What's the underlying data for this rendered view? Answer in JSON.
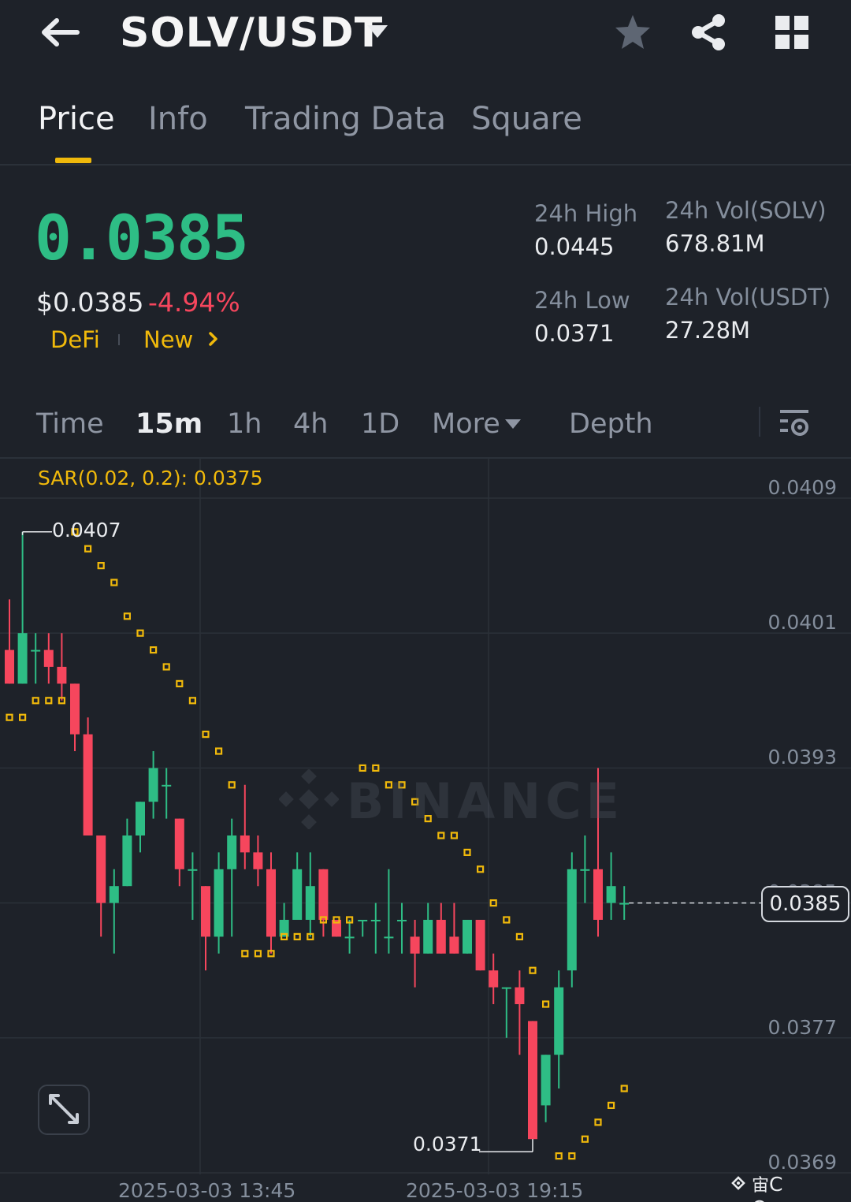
{
  "header": {
    "pair": "SOLV/USDT",
    "icons": [
      "back-arrow-icon",
      "chevron-down-icon",
      "star-icon",
      "share-icon",
      "grid-icon"
    ]
  },
  "tabs": [
    {
      "label": "Price",
      "active": true
    },
    {
      "label": "Info",
      "active": false
    },
    {
      "label": "Trading Data",
      "active": false
    },
    {
      "label": "Square",
      "active": false
    }
  ],
  "ticker": {
    "last_price": "0.0385",
    "usd_price": "$0.0385",
    "change_pct": "-4.94%",
    "tags": [
      "DeFi",
      "New"
    ],
    "stats": {
      "high_label": "24h High",
      "high_value": "0.0445",
      "low_label": "24h Low",
      "low_value": "0.0371",
      "vol_base_label": "24h Vol(SOLV)",
      "vol_base_value": "678.81M",
      "vol_quote_label": "24h Vol(USDT)",
      "vol_quote_value": "27.28M"
    }
  },
  "intervals": {
    "items": [
      "Time",
      "15m",
      "1h",
      "4h",
      "1D",
      "More"
    ],
    "active": "15m",
    "depth_label": "Depth"
  },
  "chart": {
    "indicator_label": "SAR(0.02, 0.2): 0.0375",
    "y_ticks": [
      "0.0409",
      "0.0401",
      "0.0393",
      "0.0385",
      "0.0377",
      "0.0369"
    ],
    "x_ticks": [
      "2025-03-03 13:45",
      "2025-03-03 19:15"
    ],
    "high_marker": "0.0407",
    "low_marker": "0.0371",
    "current_price_tag": "0.0385",
    "watermark": "BINANCE",
    "colors": {
      "up": "#2ebd85",
      "down": "#f6465d",
      "sar": "#f0b90b"
    }
  },
  "credit": "C Queen",
  "chart_data": {
    "type": "candlestick",
    "ylim": [
      0.0367,
      0.0411
    ],
    "y_ticks": [
      0.0409,
      0.0401,
      0.0393,
      0.0385,
      0.0377,
      0.0369
    ],
    "candles": [
      {
        "o": 0.04,
        "h": 0.0403,
        "l": 0.0398,
        "c": 0.0398
      },
      {
        "o": 0.0398,
        "h": 0.0407,
        "l": 0.0398,
        "c": 0.0401
      },
      {
        "o": 0.04,
        "h": 0.0401,
        "l": 0.0398,
        "c": 0.04
      },
      {
        "o": 0.04,
        "h": 0.0401,
        "l": 0.0398,
        "c": 0.0399
      },
      {
        "o": 0.0399,
        "h": 0.0401,
        "l": 0.0397,
        "c": 0.0398
      },
      {
        "o": 0.0398,
        "h": 0.0398,
        "l": 0.0394,
        "c": 0.0395
      },
      {
        "o": 0.0395,
        "h": 0.0396,
        "l": 0.0389,
        "c": 0.0389
      },
      {
        "o": 0.0389,
        "h": 0.0389,
        "l": 0.0383,
        "c": 0.0385
      },
      {
        "o": 0.0385,
        "h": 0.0387,
        "l": 0.0382,
        "c": 0.0386
      },
      {
        "o": 0.0386,
        "h": 0.039,
        "l": 0.0386,
        "c": 0.0389
      },
      {
        "o": 0.0389,
        "h": 0.0391,
        "l": 0.0388,
        "c": 0.0391
      },
      {
        "o": 0.0391,
        "h": 0.0394,
        "l": 0.039,
        "c": 0.0393
      },
      {
        "o": 0.0392,
        "h": 0.0393,
        "l": 0.039,
        "c": 0.0392
      },
      {
        "o": 0.039,
        "h": 0.039,
        "l": 0.0386,
        "c": 0.0387
      },
      {
        "o": 0.0387,
        "h": 0.0388,
        "l": 0.0384,
        "c": 0.0387
      },
      {
        "o": 0.0386,
        "h": 0.0386,
        "l": 0.0381,
        "c": 0.0383
      },
      {
        "o": 0.0383,
        "h": 0.0388,
        "l": 0.0382,
        "c": 0.0387
      },
      {
        "o": 0.0387,
        "h": 0.039,
        "l": 0.0383,
        "c": 0.0389
      },
      {
        "o": 0.0389,
        "h": 0.0392,
        "l": 0.0387,
        "c": 0.0388
      },
      {
        "o": 0.0388,
        "h": 0.0389,
        "l": 0.0386,
        "c": 0.0387
      },
      {
        "o": 0.0387,
        "h": 0.0388,
        "l": 0.0382,
        "c": 0.0383
      },
      {
        "o": 0.0383,
        "h": 0.0385,
        "l": 0.0383,
        "c": 0.0384
      },
      {
        "o": 0.0384,
        "h": 0.0388,
        "l": 0.0384,
        "c": 0.0387
      },
      {
        "o": 0.0384,
        "h": 0.0388,
        "l": 0.0383,
        "c": 0.0386
      },
      {
        "o": 0.0387,
        "h": 0.0387,
        "l": 0.0383,
        "c": 0.0384
      },
      {
        "o": 0.0384,
        "h": 0.0384,
        "l": 0.0383,
        "c": 0.0383
      },
      {
        "o": 0.0383,
        "h": 0.0384,
        "l": 0.0382,
        "c": 0.0383
      },
      {
        "o": 0.0384,
        "h": 0.0384,
        "l": 0.0383,
        "c": 0.0384
      },
      {
        "o": 0.0384,
        "h": 0.0385,
        "l": 0.0382,
        "c": 0.0384
      },
      {
        "o": 0.0383,
        "h": 0.0387,
        "l": 0.0382,
        "c": 0.0383
      },
      {
        "o": 0.0384,
        "h": 0.0385,
        "l": 0.0382,
        "c": 0.0384
      },
      {
        "o": 0.0383,
        "h": 0.0384,
        "l": 0.038,
        "c": 0.0382
      },
      {
        "o": 0.0382,
        "h": 0.0385,
        "l": 0.0382,
        "c": 0.0384
      },
      {
        "o": 0.0384,
        "h": 0.0385,
        "l": 0.0382,
        "c": 0.0382
      },
      {
        "o": 0.0383,
        "h": 0.0385,
        "l": 0.0382,
        "c": 0.0382
      },
      {
        "o": 0.0382,
        "h": 0.0384,
        "l": 0.0382,
        "c": 0.0384
      },
      {
        "o": 0.0384,
        "h": 0.0384,
        "l": 0.0381,
        "c": 0.0381
      },
      {
        "o": 0.0381,
        "h": 0.0382,
        "l": 0.0379,
        "c": 0.038
      },
      {
        "o": 0.038,
        "h": 0.038,
        "l": 0.0377,
        "c": 0.038
      },
      {
        "o": 0.038,
        "h": 0.0381,
        "l": 0.0376,
        "c": 0.0379
      },
      {
        "o": 0.0378,
        "h": 0.0378,
        "l": 0.0371,
        "c": 0.0371
      },
      {
        "o": 0.0373,
        "h": 0.0376,
        "l": 0.0372,
        "c": 0.0376
      },
      {
        "o": 0.0376,
        "h": 0.0381,
        "l": 0.0374,
        "c": 0.038
      },
      {
        "o": 0.0381,
        "h": 0.0388,
        "l": 0.038,
        "c": 0.0387
      },
      {
        "o": 0.0387,
        "h": 0.0389,
        "l": 0.0385,
        "c": 0.0387
      },
      {
        "o": 0.0387,
        "h": 0.0393,
        "l": 0.0383,
        "c": 0.0384
      },
      {
        "o": 0.0385,
        "h": 0.0388,
        "l": 0.0384,
        "c": 0.0386
      },
      {
        "o": 0.0385,
        "h": 0.0386,
        "l": 0.0384,
        "c": 0.0385
      }
    ],
    "sar": [
      {
        "i": 0,
        "v": 0.0396
      },
      {
        "i": 1,
        "v": 0.0396
      },
      {
        "i": 2,
        "v": 0.0397
      },
      {
        "i": 3,
        "v": 0.0397
      },
      {
        "i": 4,
        "v": 0.0397
      },
      {
        "i": 5,
        "v": 0.0407
      },
      {
        "i": 6,
        "v": 0.0406
      },
      {
        "i": 7,
        "v": 0.0405
      },
      {
        "i": 8,
        "v": 0.0404
      },
      {
        "i": 9,
        "v": 0.0402
      },
      {
        "i": 10,
        "v": 0.0401
      },
      {
        "i": 11,
        "v": 0.04
      },
      {
        "i": 12,
        "v": 0.0399
      },
      {
        "i": 13,
        "v": 0.0398
      },
      {
        "i": 14,
        "v": 0.0397
      },
      {
        "i": 15,
        "v": 0.0395
      },
      {
        "i": 16,
        "v": 0.0394
      },
      {
        "i": 17,
        "v": 0.0392
      },
      {
        "i": 18,
        "v": 0.0382
      },
      {
        "i": 19,
        "v": 0.0382
      },
      {
        "i": 20,
        "v": 0.0382
      },
      {
        "i": 21,
        "v": 0.0383
      },
      {
        "i": 22,
        "v": 0.0383
      },
      {
        "i": 23,
        "v": 0.0383
      },
      {
        "i": 24,
        "v": 0.0384
      },
      {
        "i": 25,
        "v": 0.0384
      },
      {
        "i": 26,
        "v": 0.0384
      },
      {
        "i": 27,
        "v": 0.0393
      },
      {
        "i": 28,
        "v": 0.0393
      },
      {
        "i": 29,
        "v": 0.0392
      },
      {
        "i": 30,
        "v": 0.0392
      },
      {
        "i": 31,
        "v": 0.0391
      },
      {
        "i": 32,
        "v": 0.039
      },
      {
        "i": 33,
        "v": 0.0389
      },
      {
        "i": 34,
        "v": 0.0389
      },
      {
        "i": 35,
        "v": 0.0388
      },
      {
        "i": 36,
        "v": 0.0387
      },
      {
        "i": 37,
        "v": 0.0385
      },
      {
        "i": 38,
        "v": 0.0384
      },
      {
        "i": 39,
        "v": 0.0383
      },
      {
        "i": 40,
        "v": 0.0381
      },
      {
        "i": 41,
        "v": 0.0379
      },
      {
        "i": 42,
        "v": 0.037
      },
      {
        "i": 43,
        "v": 0.037
      },
      {
        "i": 44,
        "v": 0.0371
      },
      {
        "i": 45,
        "v": 0.0372
      },
      {
        "i": 46,
        "v": 0.0373
      },
      {
        "i": 47,
        "v": 0.0374
      }
    ]
  }
}
